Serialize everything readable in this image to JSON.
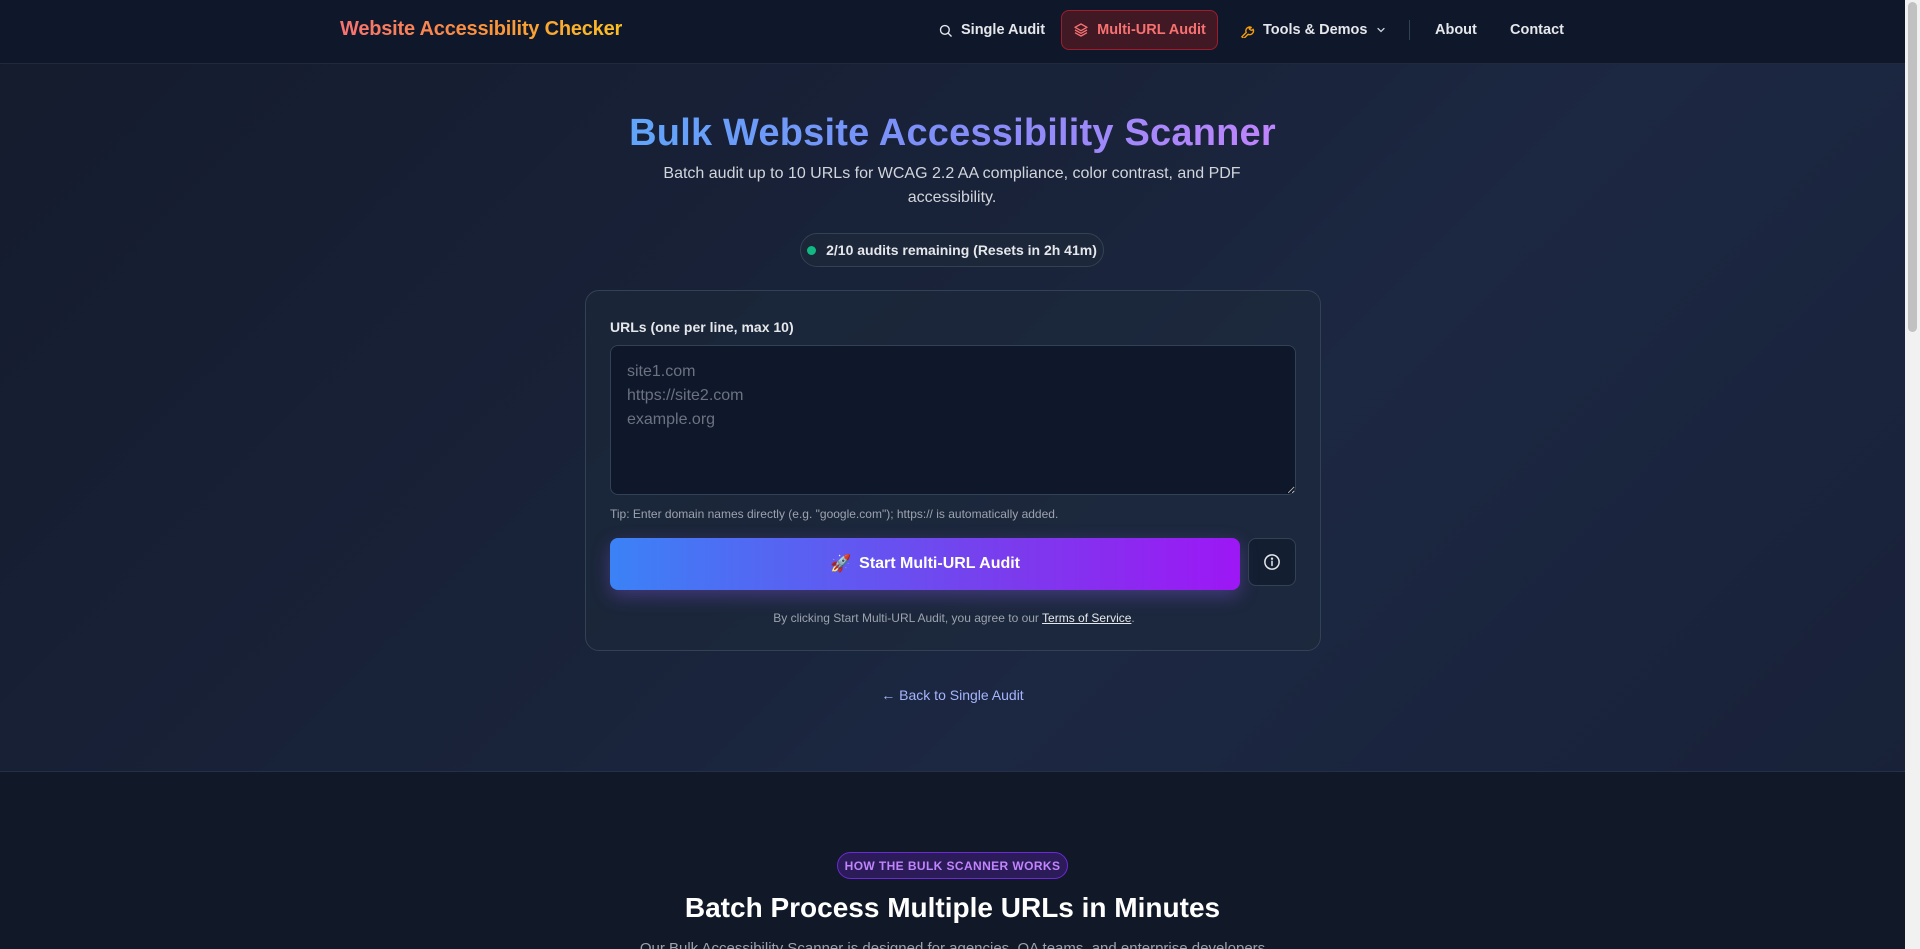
{
  "header": {
    "brand": "Website Accessibility Checker",
    "nav": {
      "single_audit": "Single Audit",
      "multi_url_audit": "Multi-URL Audit",
      "tools_demos": "Tools & Demos",
      "about": "About",
      "contact": "Contact"
    },
    "colors": {
      "background": "#0f172a",
      "active_nav_text": "#f87171"
    }
  },
  "hero": {
    "title": "Bulk Website Accessibility Scanner",
    "subtitle": "Batch audit up to 10 URLs for WCAG 2.2 AA compliance, color contrast, and PDF accessibility.",
    "quota": "2/10 audits remaining (Resets in 2h 41m)",
    "quota_status_color": "#10b981"
  },
  "form": {
    "label": "URLs (one per line, max 10)",
    "value": "",
    "placeholder": "site1.com\nhttps://site2.com\nexample.org",
    "tip": "Tip: Enter domain names directly (e.g. \"google.com\"); https:// is automatically added.",
    "start_button_icon": "🚀",
    "start_button_label": "Start Multi-URL Audit",
    "info_button_icon": "info-icon",
    "terms_prefix": "By clicking Start Multi-URL Audit, you agree to our ",
    "terms_link": "Terms of Service",
    "terms_suffix": "."
  },
  "back_link": "← Back to Single Audit",
  "how_section": {
    "badge": "HOW THE BULK SCANNER WORKS",
    "title": "Batch Process Multiple URLs in Minutes",
    "description": "Our Bulk Accessibility Scanner is designed for agencies, QA teams, and enterprise developers"
  },
  "icons": {
    "single_audit": "search-icon",
    "multi_url_audit": "layers-icon",
    "tools_demos": "wrench-icon",
    "tools_dropdown": "chevron-down-icon",
    "info": "info-icon"
  }
}
